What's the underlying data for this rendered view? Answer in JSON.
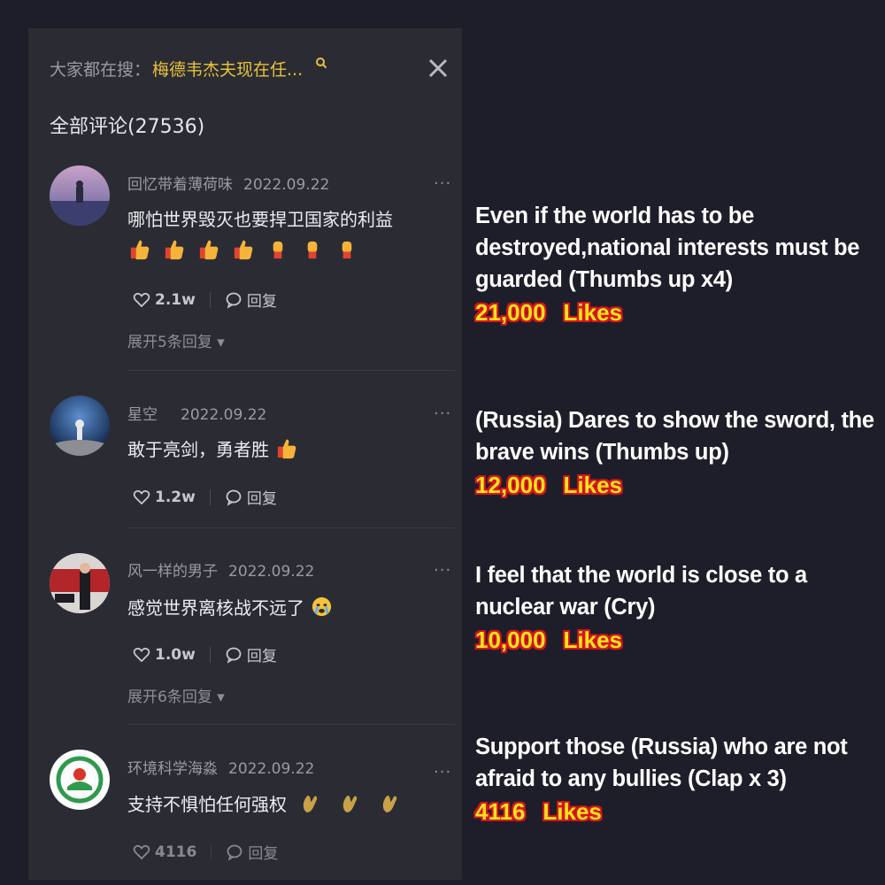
{
  "search": {
    "prefix": "大家都在搜：",
    "query": "梅德韦杰夫现在任..."
  },
  "comments_title": "全部评论(27536)",
  "comments": [
    {
      "username": "回忆带着薄荷味",
      "date": "2022.09.22",
      "text": "哪怕世界毁灭也要捍卫国家的利益",
      "emojis": [
        "thumbs-up",
        "thumbs-up",
        "thumbs-up",
        "thumbs-up",
        "fist",
        "fist",
        "fist"
      ],
      "likes": "2.1w",
      "reply_label": "回复",
      "expand": "展开5条回复 ▾"
    },
    {
      "username": "星空",
      "date": "2022.09.22",
      "text": "敢于亮剑，勇者胜",
      "emojis": [
        "thumbs-up"
      ],
      "likes": "1.2w",
      "reply_label": "回复"
    },
    {
      "username": "风一样的男子",
      "date": "2022.09.22",
      "text": "感觉世界离核战不远了",
      "emojis": [
        "crying-face"
      ],
      "likes": "1.0w",
      "reply_label": "回复",
      "expand": "展开6条回复 ▾"
    },
    {
      "username": "环境科学海淼",
      "date": "2022.09.22",
      "text": "支持不惧怕任何强权",
      "emojis": [
        "clapping-hands",
        "clapping-hands",
        "clapping-hands"
      ],
      "likes": "4116",
      "reply_label": "回复"
    }
  ],
  "annotations": [
    {
      "text": "Even if the world has to be destroyed,national interests must be guarded (Thumbs up x4)",
      "likes_num": "21,000",
      "likes_word": "Likes"
    },
    {
      "text": "(Russia) Dares to show the sword, the brave wins (Thumbs up)",
      "likes_num": "12,000",
      "likes_word": "Likes"
    },
    {
      "text": "I feel that the world is close to a nuclear war (Cry)",
      "likes_num": "10,000",
      "likes_word": "Likes"
    },
    {
      "text": "Support those (Russia) who are not afraid to any bullies (Clap x 3)",
      "likes_num": "4116",
      "likes_word": "Likes"
    }
  ],
  "colors": {
    "background": "#1e1e2a",
    "panel": "#2b2c33",
    "search_query": "#e8c23a",
    "likes_fill": "#ffe21a",
    "likes_outline": "#d4151c"
  }
}
